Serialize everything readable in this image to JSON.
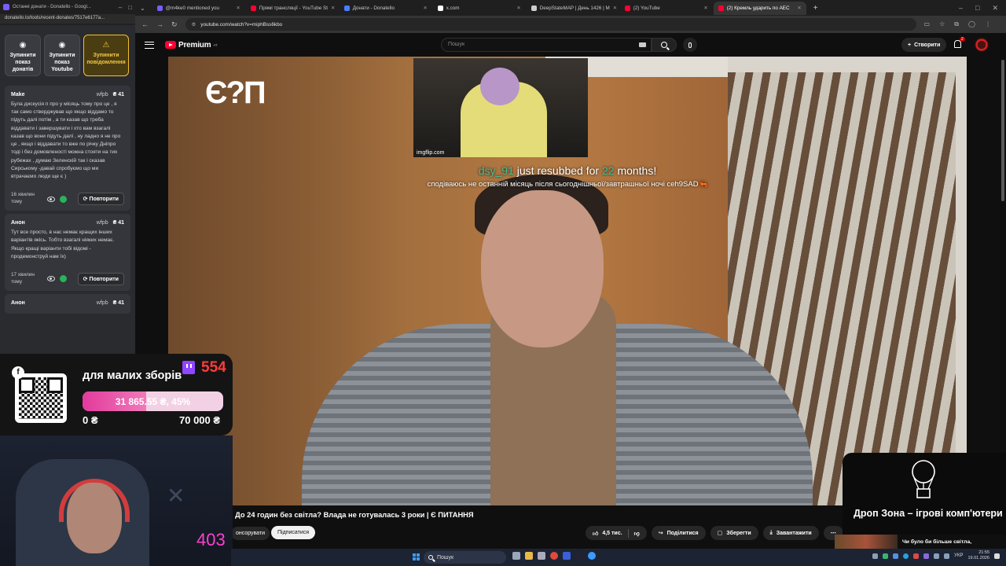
{
  "donatello_window": {
    "tab_title": "Останні донати - Donatello - Googl...",
    "url": "donatello.to/tools/recent-donates/7517e6177a...",
    "buttons": [
      {
        "label": "Зупинити показ донатів"
      },
      {
        "label": "Зупинити показ Youtube"
      },
      {
        "label": "Зупинити повідомлення"
      }
    ],
    "donations": [
      {
        "name": "Make",
        "user": "wfpb",
        "amount": "₴ 41",
        "text": "Була дискусія п про у місяць тому про це , я так само стверджував що якщо віддамо то підуть далі потім , а ти казав що треба віддавати і завершувати і хто вам взагалі казав що вони підуть далі , ну ладно я не про це , якщо і віддавати то вже по річку Дніпро тоді і без домовленості можна стояти на тих рубежах , думаю Зеленскій так і сказав Сирському -давай спробуємо що ми втрачаємо люди ще є )",
        "time": "16 хвилин тому",
        "repeat_label": "Повторити"
      },
      {
        "name": "Анон",
        "user": "wfpb",
        "amount": "₴ 41",
        "text": "Тут все просто, в нас немає кращих інших варіантів якісь. Тобто взагалі ніяких немає. Якщо кращі варіанти тобі відомі - продемонструй нам їх)",
        "time": "17 хвилин тому",
        "repeat_label": "Повторити"
      },
      {
        "name": "Анон",
        "user": "wfpb",
        "amount": "₴ 41"
      }
    ]
  },
  "tabs": [
    {
      "label": "@m4ke0 mentioned you",
      "color": "#7b5cff"
    },
    {
      "label": "Прямі трансляції - YouTube St",
      "color": "#ff0033"
    },
    {
      "label": "Донати - Donatello",
      "color": "#4a7dff"
    },
    {
      "label": "x.com",
      "color": "#ffffff"
    },
    {
      "label": "DeepStateMAP | День 1426 | М",
      "color": "#cccccc"
    },
    {
      "label": "(2) YouTube",
      "color": "#ff0033"
    },
    {
      "label": "(2) Кремль ударить по АЕС",
      "color": "#ff0033",
      "active": true
    }
  ],
  "address_bar": {
    "url": "youtube.com/watch?v=miphBss6kbo"
  },
  "youtube": {
    "logo": "Premium",
    "logo_region": "AT",
    "search_placeholder": "Пошук",
    "create_label": "Створити",
    "notification_count": "2"
  },
  "video": {
    "channel_logo": "Є?П",
    "gif_caption": "imgflip.com",
    "resub_user": "dsy_91",
    "resub_mid": "just resubbed for",
    "resub_months": "22",
    "resub_end": "months!",
    "resub_message": "сподіваюсь не останній місяць після сьогоднішньої/завтрашньої ночі ceh9SAD🦐"
  },
  "video_info": {
    "title": ". До 24 годин без світла? Влада не готувалась 3 роки | Є ПИТАННЯ",
    "sponsor_label": "онсорувати",
    "subscribe_label": "Підписатися",
    "likes": "4,5 тис.",
    "share_label": "Поділитися",
    "save_label": "Зберегти",
    "download_label": "Завантажити"
  },
  "donation_goal": {
    "title": "для малих зборів",
    "twitch_count": "554",
    "progress_text": "31 865.55 ₴, 45%",
    "progress_fraction": 0.45,
    "min": "0 ₴",
    "max": "70 000 ₴"
  },
  "webcam": {
    "viewer_count": "403"
  },
  "ad": {
    "title": "Дроп Зона – ігрові комп'ютери"
  },
  "recommendation": {
    "title": "Чи було би більше світла,"
  },
  "taskbar": {
    "search_label": "Пошук",
    "language": "УКР",
    "time": "21:55",
    "date": "19.01.2026"
  }
}
